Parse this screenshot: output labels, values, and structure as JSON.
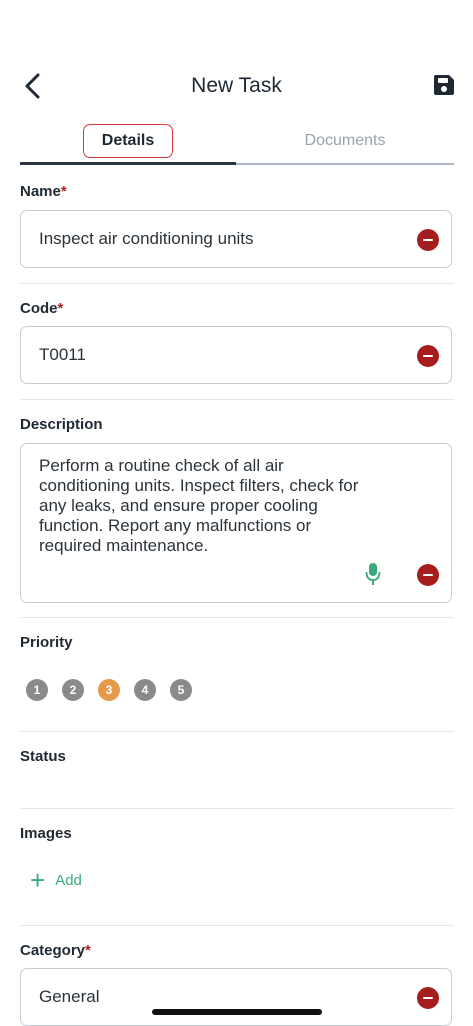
{
  "header": {
    "title": "New Task"
  },
  "tabs": [
    {
      "label": "Details"
    },
    {
      "label": "Documents"
    }
  ],
  "fields": {
    "name": {
      "label": "Name",
      "required": "*",
      "value": "Inspect air conditioning units"
    },
    "code": {
      "label": "Code",
      "required": "*",
      "value": "T0011"
    },
    "description": {
      "label": "Description",
      "value": "Perform a routine check of all air conditioning units. Inspect filters, check for any leaks, and ensure proper cooling function. Report any malfunctions or required maintenance."
    },
    "priority": {
      "label": "Priority",
      "options": [
        "1",
        "2",
        "3",
        "4",
        "5"
      ],
      "selected": "3"
    },
    "status": {
      "label": "Status"
    },
    "images": {
      "label": "Images",
      "add_label": "Add"
    },
    "category": {
      "label": "Category",
      "required": "*",
      "value": "General"
    }
  },
  "colors": {
    "accent": "#e59a4b",
    "remove": "#a51d1d",
    "add": "#3aaa7a",
    "required": "#b22222"
  },
  "icons": {
    "back": "chevron-left-icon",
    "save": "floppy-disk-icon",
    "remove": "minus-circle-icon",
    "mic": "microphone-icon",
    "add": "plus-icon"
  }
}
